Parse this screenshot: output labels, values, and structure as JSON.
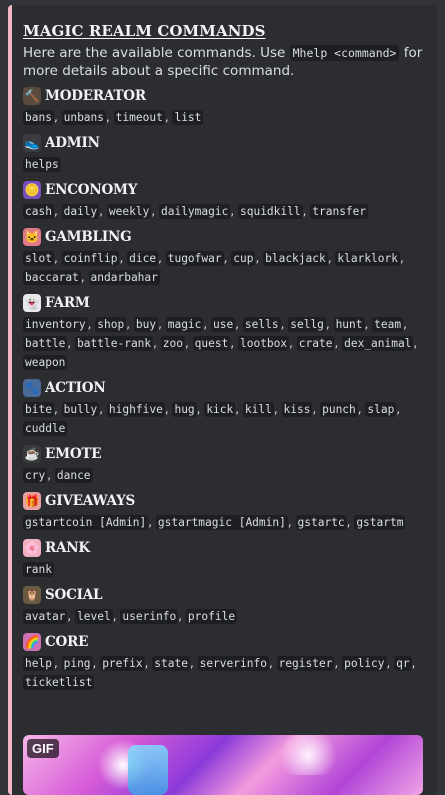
{
  "embed": {
    "title": "MAGIC REALM COMMANDS",
    "description_before": "Here are the available commands. Use ",
    "description_code": "Mhelp <command>",
    "description_after": " for more details about a specific command.",
    "accent_color": "#f4b6c2",
    "gif_badge": "GIF"
  },
  "sections": [
    {
      "icon": "gavel-icon",
      "emoji": "🔨",
      "title": "MODERATOR",
      "commands": [
        "bans",
        "unbans",
        "timeout",
        "list"
      ]
    },
    {
      "icon": "shoe-icon",
      "emoji": "👟",
      "title": "ADMIN",
      "commands": [
        "helps"
      ]
    },
    {
      "icon": "coin-icon",
      "emoji": "🪙",
      "title": "ENCONOMY",
      "commands": [
        "cash",
        "daily",
        "weekly",
        "dailymagic",
        "squidkill",
        "transfer"
      ]
    },
    {
      "icon": "cat-icon",
      "emoji": "🐱",
      "title": "GAMBLING",
      "commands": [
        "slot",
        "coinflip",
        "dice",
        "tugofwar",
        "cup",
        "blackjack",
        "klarklork",
        "baccarat",
        "andarbahar"
      ]
    },
    {
      "icon": "ghost-cat-icon",
      "emoji": "👻",
      "title": "FARM",
      "commands": [
        "inventory",
        "shop",
        "buy",
        "magic",
        "use",
        "sells",
        "sellg",
        "hunt",
        "team",
        "battle",
        "battle-rank",
        "zoo",
        "quest",
        "lootbox",
        "crate",
        "dex_animal",
        "weapon"
      ]
    },
    {
      "icon": "cat-hand-icon",
      "emoji": "🐾",
      "title": "ACTION",
      "commands": [
        "bite",
        "bully",
        "highfive",
        "hug",
        "kick",
        "kill",
        "kiss",
        "punch",
        "slap",
        "cuddle"
      ]
    },
    {
      "icon": "cup-icon",
      "emoji": "☕",
      "title": "EMOTE",
      "commands": [
        "cry",
        "dance"
      ]
    },
    {
      "icon": "gift-icon",
      "emoji": "🎁",
      "title": "GIVEAWAYS",
      "commands": [
        "gstartcoin [Admin]",
        "gstartmagic [Admin]",
        "gstartc",
        "gstartm"
      ]
    },
    {
      "icon": "paw-icon",
      "emoji": "🌸",
      "title": "RANK",
      "commands": [
        "rank"
      ]
    },
    {
      "icon": "owl-icon",
      "emoji": "🦉",
      "title": "SOCIAL",
      "commands": [
        "avatar",
        "level",
        "userinfo",
        "profile"
      ]
    },
    {
      "icon": "rainbow-icon",
      "emoji": "🌈",
      "title": "CORE",
      "commands": [
        "help",
        "ping",
        "prefix",
        "state",
        "serverinfo",
        "register",
        "policy",
        "qr",
        "ticketlist"
      ]
    }
  ]
}
